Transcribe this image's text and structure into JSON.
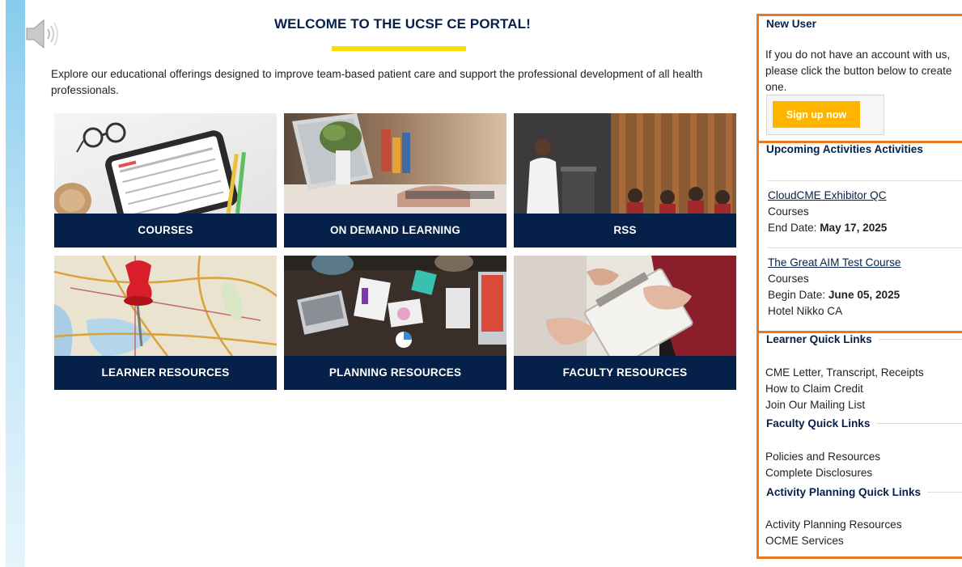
{
  "header": {
    "title": "WELCOME TO THE UCSF CE PORTAL!",
    "intro": "Explore our educational offerings designed to improve team-based patient care and support the professional development of all health professionals.",
    "speaker_icon": "speaker-volume-icon"
  },
  "tiles": [
    {
      "label": "COURSES",
      "image": "calendar-tablet-image"
    },
    {
      "label": "ON DEMAND LEARNING",
      "image": "laptop-desk-image"
    },
    {
      "label": "RSS",
      "image": "conference-speaker-image"
    },
    {
      "label": "LEARNER RESOURCES",
      "image": "map-pushpin-image"
    },
    {
      "label": "PLANNING RESOURCES",
      "image": "team-table-image"
    },
    {
      "label": "FACULTY RESOURCES",
      "image": "clipboard-hands-image"
    }
  ],
  "sidebar": {
    "new_user": {
      "heading": "New User",
      "text": "If you do not have an account with us, please click the button below to create one.",
      "button": "Sign up now"
    },
    "upcoming": {
      "heading": "Upcoming Activities Activities",
      "items": [
        {
          "title": "CloudCME Exhibitor QC",
          "type": "Courses",
          "date_label": "End Date: ",
          "date": "May 17, 2025",
          "location": ""
        },
        {
          "title": "The Great AIM Test Course",
          "type": "Courses",
          "date_label": "Begin Date: ",
          "date": "June 05, 2025",
          "location": "Hotel Nikko CA"
        }
      ]
    },
    "learner": {
      "heading": "Learner Quick Links",
      "links": [
        "CME Letter, Transcript, Receipts",
        "How to Claim Credit",
        "Join Our Mailing List"
      ]
    },
    "faculty": {
      "heading": "Faculty Quick Links",
      "links": [
        "Policies and Resources",
        "Complete Disclosures"
      ]
    },
    "planning": {
      "heading": "Activity Planning Quick Links",
      "links": [
        "Activity Planning Resources",
        "OCME Services"
      ]
    }
  },
  "colors": {
    "navy": "#052049",
    "yellow": "#ffdd00",
    "signup": "#ffb500",
    "sidebar_border": "#e87722"
  }
}
